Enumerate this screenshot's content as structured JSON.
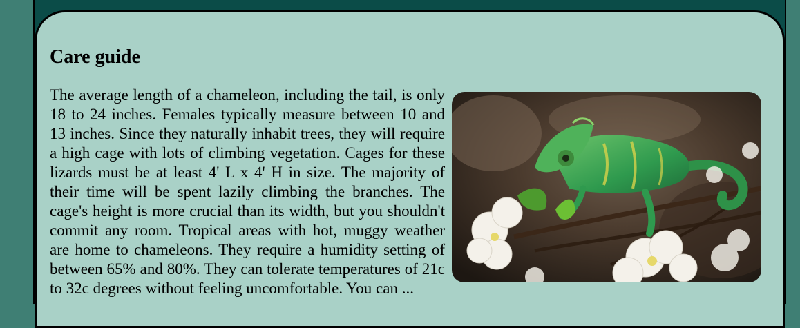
{
  "section": {
    "title": "Care guide",
    "body": "The average length of a chameleon, including the tail, is only 18 to 24 inches. Females typically measure between 10 and 13 inches. Since they naturally inhabit trees, they will require a high cage with lots of climbing vegetation. Cages for these lizards must be at least 4' L x 4' H in size. The majority of their time will be spent lazily climbing the branches. The cage's height is more crucial than its width, but you shouldn't commit any room. Tropical areas with hot, muggy weather are home to chameleons. They require a humidity setting of between 65% and 80%. They can tolerate temperatures of 21c to 32c degrees without feeling uncomfortable. You can ..."
  },
  "image": {
    "subject": "chameleon-photo"
  },
  "colors": {
    "page_background": "#3f7f74",
    "frame": "#0b4c48",
    "card": "#a9d1c7"
  }
}
